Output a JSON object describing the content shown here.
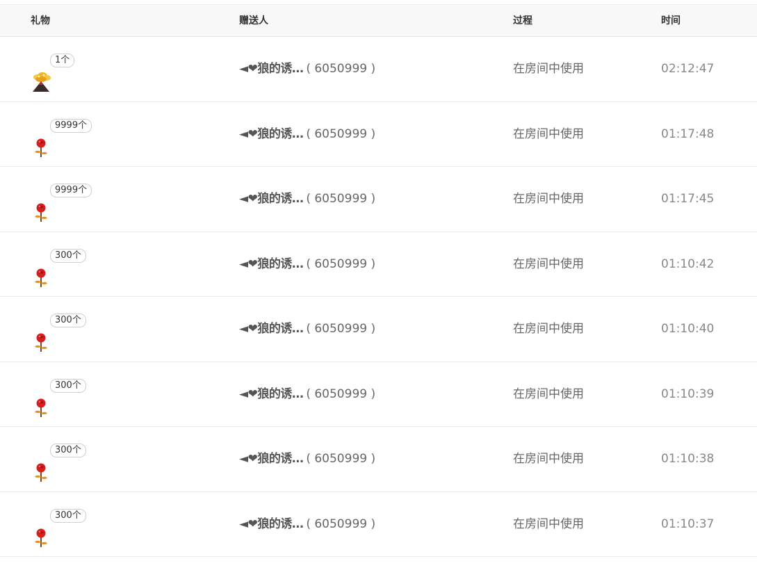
{
  "header": {
    "gift": "礼物",
    "sender": "赠送人",
    "process": "过程",
    "time": "时间"
  },
  "rows": [
    {
      "icon": "volcano-gift-icon",
      "count": "1个",
      "sender_name": "◄❤狼的诱…",
      "sender_id": "( 6050999 )",
      "process": "在房间中使用",
      "time": "02:12:47"
    },
    {
      "icon": "rose-gift-icon",
      "count": "9999个",
      "sender_name": "◄❤狼的诱…",
      "sender_id": "( 6050999 )",
      "process": "在房间中使用",
      "time": "01:17:48"
    },
    {
      "icon": "rose-gift-icon",
      "count": "9999个",
      "sender_name": "◄❤狼的诱…",
      "sender_id": "( 6050999 )",
      "process": "在房间中使用",
      "time": "01:17:45"
    },
    {
      "icon": "rose-gift-icon",
      "count": "300个",
      "sender_name": "◄❤狼的诱…",
      "sender_id": "( 6050999 )",
      "process": "在房间中使用",
      "time": "01:10:42"
    },
    {
      "icon": "rose-gift-icon",
      "count": "300个",
      "sender_name": "◄❤狼的诱…",
      "sender_id": "( 6050999 )",
      "process": "在房间中使用",
      "time": "01:10:40"
    },
    {
      "icon": "rose-gift-icon",
      "count": "300个",
      "sender_name": "◄❤狼的诱…",
      "sender_id": "( 6050999 )",
      "process": "在房间中使用",
      "time": "01:10:39"
    },
    {
      "icon": "rose-gift-icon",
      "count": "300个",
      "sender_name": "◄❤狼的诱…",
      "sender_id": "( 6050999 )",
      "process": "在房间中使用",
      "time": "01:10:38"
    },
    {
      "icon": "rose-gift-icon",
      "count": "300个",
      "sender_name": "◄❤狼的诱…",
      "sender_id": "( 6050999 )",
      "process": "在房间中使用",
      "time": "01:10:37"
    }
  ]
}
